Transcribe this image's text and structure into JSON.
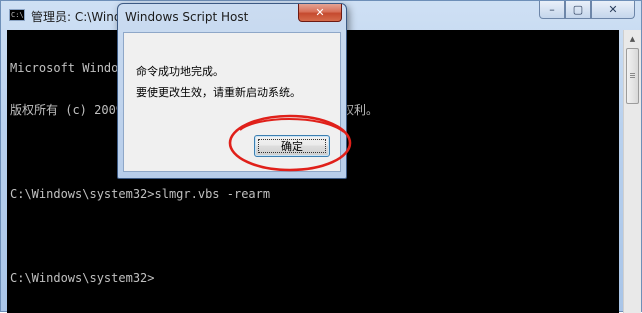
{
  "cmd_window": {
    "icon_text": "C:\\",
    "title": "管理员: C:\\Windows\\system32\\cmd.exe",
    "minimize_glyph": "–",
    "maximize_glyph": "▢",
    "close_glyph": "✕",
    "console_lines": [
      "Microsoft Windows [版本 6.1.7601]",
      "版权所有 (c) 2009 Microsoft Corporation。保留所有权利。",
      "",
      "C:\\Windows\\system32>slmgr.vbs -rearm",
      "",
      "C:\\Windows\\system32>"
    ],
    "scroll_up_glyph": "▲"
  },
  "msgbox": {
    "title": "Windows Script Host",
    "close_glyph": "✕",
    "message_line1": "命令成功地完成。",
    "message_line2": "要使更改生效，请重新启动系统。",
    "ok_label": "确定"
  },
  "annotation": {
    "color": "#e0201a"
  }
}
